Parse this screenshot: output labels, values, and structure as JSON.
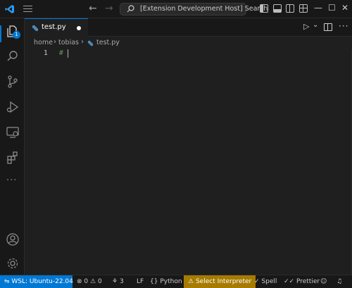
{
  "titlebar": {
    "search_text": "[Extension Development Host] Search"
  },
  "activity": {
    "explorer_badge": "1",
    "more_label": "···"
  },
  "tab": {
    "label": "test.py"
  },
  "breadcrumb": {
    "items": [
      "home",
      "tobias",
      "test.py"
    ]
  },
  "editor": {
    "line_numbers": [
      "1"
    ],
    "lines": [
      "#"
    ]
  },
  "statusbar": {
    "remote": "WSL: Ubuntu-22.04",
    "errors": "0",
    "warnings": "0",
    "ports": "3",
    "eol": "LF",
    "language": "Python",
    "interpreter": "Select Interpreter",
    "spell": "Spell",
    "prettier": "Prettier"
  },
  "colors": {
    "accent": "#0078d4",
    "warning_bg": "#a67b00",
    "background": "#1f1f1f",
    "chrome": "#181818",
    "comment": "#6a9955"
  }
}
